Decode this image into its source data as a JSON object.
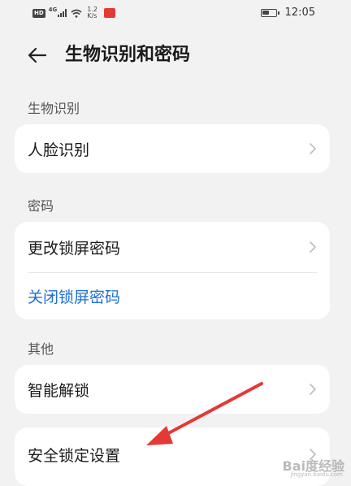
{
  "status_bar": {
    "hd": "HD",
    "network": "4G",
    "speed_value": "1.2",
    "speed_unit": "K/s",
    "time": "12:05",
    "battery_level": 0.55
  },
  "header": {
    "title": "生物识别和密码"
  },
  "sections": {
    "biometric": {
      "label": "生物识别",
      "items": [
        {
          "label": "人脸识别"
        }
      ]
    },
    "password": {
      "label": "密码",
      "items": [
        {
          "label": "更改锁屏密码"
        },
        {
          "label": "关闭锁屏密码"
        }
      ]
    },
    "other": {
      "label": "其他",
      "items": [
        {
          "label": "智能解锁"
        },
        {
          "label": "安全锁定设置"
        }
      ]
    }
  },
  "colors": {
    "background": "#f2f2f2",
    "card": "#ffffff",
    "link": "#1e6fd9",
    "annotation_arrow": "#e53935"
  },
  "watermark": {
    "text": "Bai度经验",
    "sub": "jingyan.baidu.com"
  }
}
